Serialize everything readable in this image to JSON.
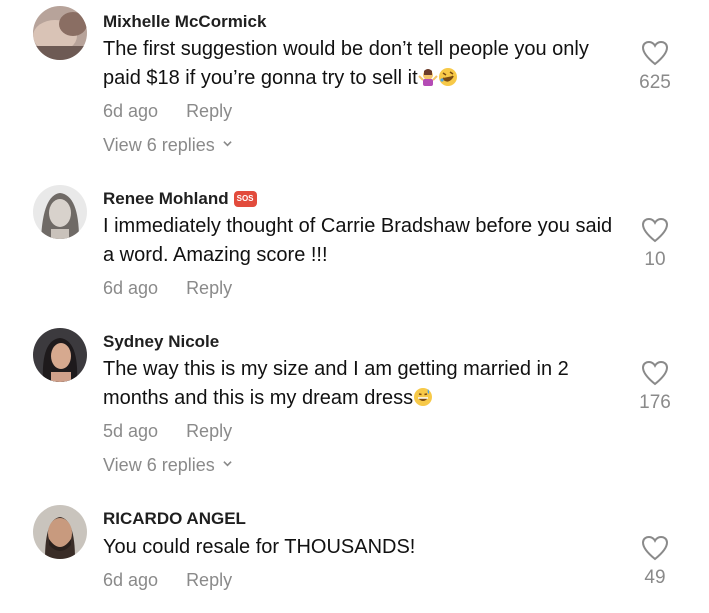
{
  "comments": [
    {
      "username": "Mixhelle McCormick",
      "text": "The first suggestion would be don’t tell people you only paid $18 if you’re gonna try to sell it",
      "text_emojis": [
        "woman-shrugging-emoji",
        "rofl-emoji"
      ],
      "time": "6d ago",
      "reply_label": "Reply",
      "view_replies": "View 6 replies",
      "likes": "625"
    },
    {
      "username": "Renee Mohland",
      "name_badge": "SOS",
      "text": "I immediately thought of Carrie Bradshaw before you said a word. Amazing score !!!",
      "time": "6d ago",
      "reply_label": "Reply",
      "likes": "10"
    },
    {
      "username": "Sydney Nicole",
      "text": "The way this is my size and I am getting married in 2 months and this is my dream dress",
      "text_emojis": [
        "grinning-sweat-emoji"
      ],
      "time": "5d ago",
      "reply_label": "Reply",
      "view_replies": "View 6 replies",
      "likes": "176"
    },
    {
      "username": "RICARDO ANGEL",
      "text": "You could resale for THOUSANDS!",
      "time": "6d ago",
      "reply_label": "Reply",
      "likes": "49"
    }
  ],
  "colors": {
    "text": "#111111",
    "muted": "#8a8a8a",
    "sos_badge": "#e24b3c"
  }
}
